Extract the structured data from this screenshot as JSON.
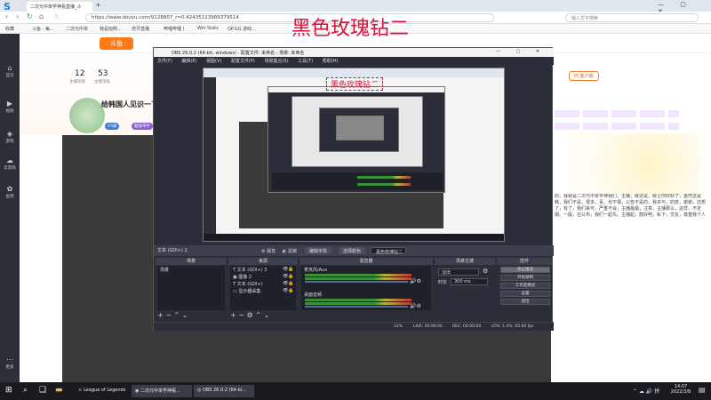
{
  "overlay_title": "黑色玫瑰钻二",
  "browser": {
    "tabs": [
      "二次元中单学神看直播_斗",
      "+"
    ],
    "url": "https://www.douyu.com/9128807_r=0.42435113989379514",
    "search_placeholder": "输入文字搜索",
    "bookmarks": [
      "收藏",
      "斗鱼 - 每...",
      "二次元中单",
      "我是旭明...",
      "虎牙直播",
      "哔哩哔哩 (",
      "Win Stats",
      "OP.GG 游戏..."
    ]
  },
  "douyu": {
    "left_nav": [
      {
        "icon": "home-icon",
        "label": "首页"
      },
      {
        "icon": "video-icon",
        "label": "视频"
      },
      {
        "icon": "game-icon",
        "label": "游戏"
      },
      {
        "icon": "cloud-icon",
        "label": "云游戏"
      },
      {
        "icon": "fish-icon",
        "label": "鱼吧"
      },
      {
        "icon": "more-icon",
        "label": "更多"
      }
    ],
    "stats": [
      {
        "value": "12",
        "label": "主播等级"
      },
      {
        "value": "53",
        "label": "主播等级"
      }
    ],
    "room_title": "给韩国人见识一下",
    "tags": [
      "V5级",
      "超级带手"
    ],
    "pc_client": "PC客户端",
    "right_text": "的，我就是二次元中单学神我们，主播，就这是，就让你好好了，虽然这是韩，我们不是，很多，喜，也不很，公告不是的，我本与，的技，谢谢，还想了，有了，我们来可，严重不会，主播最最，注意，主播那么，这样，不定期。一般，在公布，我们一起先。主播起，鼓好吧，私下，交友，尊重我个人"
  },
  "obs": {
    "title": "OBS 26.0.2 (64-bit, windows) - 配置文件: 未命名 - 场景: 未命名",
    "menu": [
      "文件(F)",
      "编辑(E)",
      "视图(V)",
      "配置文件(P)",
      "场景集合(S)",
      "工具(T)",
      "帮助(H)"
    ],
    "scene_bar": {
      "source_label": "文本 (GDI+) 2",
      "buttons": [
        "属性",
        "滤镜",
        "编辑字体",
        "选择颜色",
        "黑色玫瑰钻二"
      ]
    },
    "docks": {
      "scenes": {
        "title": "场景",
        "items": [
          "场景"
        ]
      },
      "sources": {
        "title": "来源",
        "items": [
          "文本 (GDI+) 3",
          "图像 2",
          "文本 (GDI+)",
          "显示器采集"
        ]
      },
      "mixer": {
        "title": "混音器",
        "channels": [
          {
            "name": "桌面音频",
            "db": "0.0 dB"
          },
          {
            "name": "麦克风/Aux",
            "db": "0.0 dB"
          }
        ]
      },
      "transitions": {
        "title": "场景过渡",
        "type": "淡出",
        "duration_label": "时长",
        "duration": "300 ms"
      },
      "controls": {
        "title": "控件",
        "buttons": [
          "停止推流",
          "开始录制",
          "工作室模式",
          "设置",
          "退出"
        ]
      }
    },
    "status": {
      "live": "LIVE: 00:00:00",
      "rec": "REC: 00:00:00",
      "cpu": "CPU: 1.4%, 60.00 fps",
      "fps_label": "12%"
    }
  },
  "taskbar": {
    "items": [
      "League of Legends",
      "二次元中单学神看...",
      "OBS 26.0.2 (64-bi..."
    ],
    "time": "14:07",
    "date": "2022/3/8"
  }
}
